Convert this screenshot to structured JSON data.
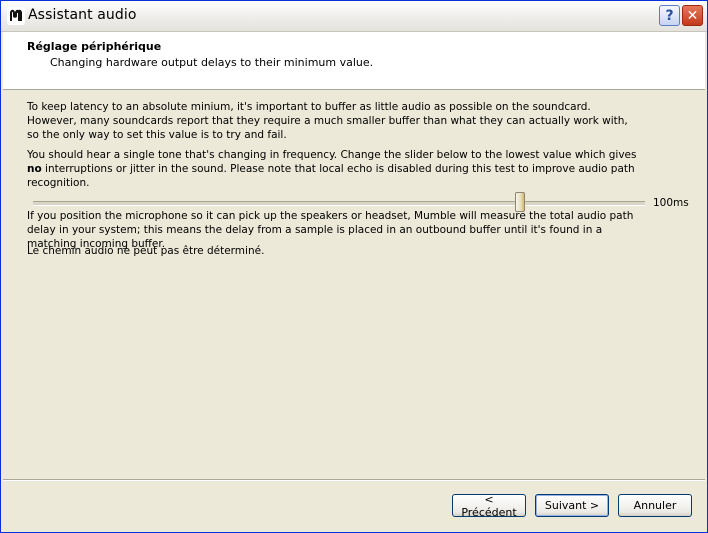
{
  "window": {
    "title": "Assistant audio"
  },
  "header": {
    "title": "Réglage périphérique",
    "subtitle": "Changing hardware output delays to their minimum value."
  },
  "content": {
    "paragraph1": "To keep latency to an absolute minium, it's important to buffer as little audio as possible on the soundcard. However, many soundcards report that they require a much smaller buffer than what they can actually work with, so the only way to set this value is to try and fail.",
    "paragraph2_before": "You should hear a single tone that's changing in frequency. Change the slider below to the lowest value which gives ",
    "paragraph2_bold": "no",
    "paragraph2_after": " interruptions or jitter in the sound. Please note that local echo is disabled during this test to improve audio path recognition.",
    "slider": {
      "value_label": "100ms",
      "position_fraction": 0.8
    },
    "paragraph3": "If you position the microphone so it can pick up the speakers or headset, Mumble will measure the total audio path delay in your system; this means the delay from a sample is placed in an outbound buffer until it's found in a matching incoming buffer.",
    "paragraph4": "Le chemin audio ne peut pas être déterminé."
  },
  "buttons": {
    "back": "< Précédent",
    "next": "Suivant >",
    "cancel": "Annuler"
  },
  "titlebar_buttons": {
    "help": "?",
    "close": "✕"
  }
}
